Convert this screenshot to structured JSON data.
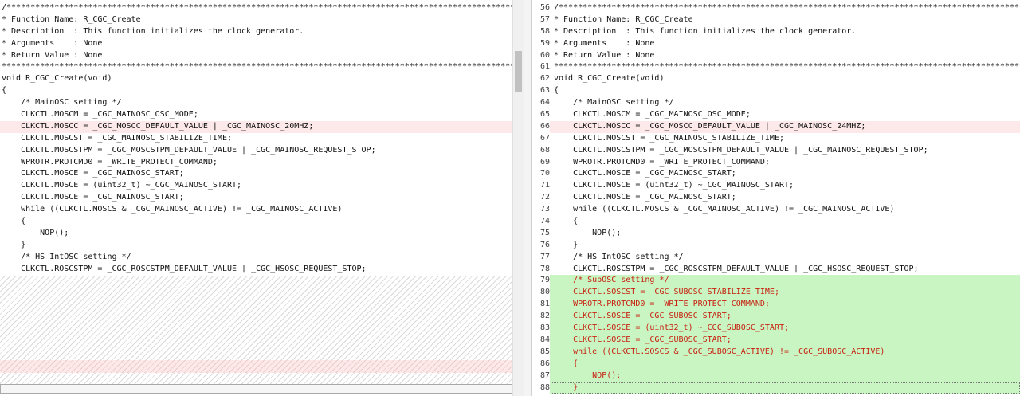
{
  "left_lines": [
    {
      "text": "/*******************************************************************************************************************************",
      "state": "normal"
    },
    {
      "text": "* Function Name: R_CGC_Create",
      "state": "normal"
    },
    {
      "text": "* Description  : This function initializes the clock generator.",
      "state": "normal"
    },
    {
      "text": "* Arguments    : None",
      "state": "normal"
    },
    {
      "text": "* Return Value : None",
      "state": "normal"
    },
    {
      "text": "*******************************************************************************************************************************/",
      "state": "normal"
    },
    {
      "text": "void R_CGC_Create(void)",
      "state": "normal"
    },
    {
      "text": "{",
      "state": "normal"
    },
    {
      "text": "    /* MainOSC setting */",
      "state": "normal"
    },
    {
      "text": "    CLKCTL.MOSCM = _CGC_MAINOSC_OSC_MODE;",
      "state": "normal"
    },
    {
      "text": "    CLKCTL.MOSCC = _CGC_MOSCC_DEFAULT_VALUE | _CGC_MAINOSC_20MHZ;",
      "state": "changed"
    },
    {
      "text": "    CLKCTL.MOSCST = _CGC_MAINOSC_STABILIZE_TIME;",
      "state": "normal"
    },
    {
      "text": "    CLKCTL.MOSCSTPM = _CGC_MOSCSTPM_DEFAULT_VALUE | _CGC_MAINOSC_REQUEST_STOP;",
      "state": "normal"
    },
    {
      "text": "    WPROTR.PROTCMD0 = _WRITE_PROTECT_COMMAND;",
      "state": "normal"
    },
    {
      "text": "    CLKCTL.MOSCE = _CGC_MAINOSC_START;",
      "state": "normal"
    },
    {
      "text": "    CLKCTL.MOSCE = (uint32_t) ~_CGC_MAINOSC_START;",
      "state": "normal"
    },
    {
      "text": "    CLKCTL.MOSCE = _CGC_MAINOSC_START;",
      "state": "normal"
    },
    {
      "text": "    while ((CLKCTL.MOSCS & _CGC_MAINOSC_ACTIVE) != _CGC_MAINOSC_ACTIVE)",
      "state": "normal"
    },
    {
      "text": "    {",
      "state": "normal"
    },
    {
      "text": "        NOP();",
      "state": "normal"
    },
    {
      "text": "    }",
      "state": "normal"
    },
    {
      "text": "    /* HS IntOSC setting */",
      "state": "normal"
    },
    {
      "text": "    CLKCTL.ROSCSTPM = _CGC_ROSCSTPM_DEFAULT_VALUE | _CGC_HSOSC_REQUEST_STOP;",
      "state": "normal"
    }
  ],
  "right_lines": [
    {
      "num": "56",
      "text": "/*****************************************************************************************************************",
      "state": "normal"
    },
    {
      "num": "57",
      "text": "* Function Name: R_CGC_Create",
      "state": "normal"
    },
    {
      "num": "58",
      "text": "* Description  : This function initializes the clock generator.",
      "state": "normal"
    },
    {
      "num": "59",
      "text": "* Arguments    : None",
      "state": "normal"
    },
    {
      "num": "60",
      "text": "* Return Value : None",
      "state": "normal"
    },
    {
      "num": "61",
      "text": "*****************************************************************************************************************/",
      "state": "normal"
    },
    {
      "num": "62",
      "text": "void R_CGC_Create(void)",
      "state": "normal"
    },
    {
      "num": "63",
      "text": "{",
      "state": "normal"
    },
    {
      "num": "64",
      "text": "    /* MainOSC setting */",
      "state": "normal"
    },
    {
      "num": "65",
      "text": "    CLKCTL.MOSCM = _CGC_MAINOSC_OSC_MODE;",
      "state": "normal"
    },
    {
      "num": "66",
      "text": "    CLKCTL.MOSCC = _CGC_MOSCC_DEFAULT_VALUE | _CGC_MAINOSC_24MHZ;",
      "state": "changed"
    },
    {
      "num": "67",
      "text": "    CLKCTL.MOSCST = _CGC_MAINOSC_STABILIZE_TIME;",
      "state": "normal"
    },
    {
      "num": "68",
      "text": "    CLKCTL.MOSCSTPM = _CGC_MOSCSTPM_DEFAULT_VALUE | _CGC_MAINOSC_REQUEST_STOP;",
      "state": "normal"
    },
    {
      "num": "69",
      "text": "    WPROTR.PROTCMD0 = _WRITE_PROTECT_COMMAND;",
      "state": "normal"
    },
    {
      "num": "70",
      "text": "    CLKCTL.MOSCE = _CGC_MAINOSC_START;",
      "state": "normal"
    },
    {
      "num": "71",
      "text": "    CLKCTL.MOSCE = (uint32_t) ~_CGC_MAINOSC_START;",
      "state": "normal"
    },
    {
      "num": "72",
      "text": "    CLKCTL.MOSCE = _CGC_MAINOSC_START;",
      "state": "normal"
    },
    {
      "num": "73",
      "text": "    while ((CLKCTL.MOSCS & _CGC_MAINOSC_ACTIVE) != _CGC_MAINOSC_ACTIVE)",
      "state": "normal"
    },
    {
      "num": "74",
      "text": "    {",
      "state": "normal"
    },
    {
      "num": "75",
      "text": "        NOP();",
      "state": "normal"
    },
    {
      "num": "76",
      "text": "    }",
      "state": "normal"
    },
    {
      "num": "77",
      "text": "    /* HS IntOSC setting */",
      "state": "normal"
    },
    {
      "num": "78",
      "text": "    CLKCTL.ROSCSTPM = _CGC_ROSCSTPM_DEFAULT_VALUE | _CGC_HSOSC_REQUEST_STOP;",
      "state": "normal"
    },
    {
      "num": "79",
      "text": "    /* SubOSC setting */",
      "state": "added"
    },
    {
      "num": "80",
      "text": "    CLKCTL.SOSCST = _CGC_SUBOSC_STABILIZE_TIME;",
      "state": "added"
    },
    {
      "num": "81",
      "text": "    WPROTR.PROTCMD0 = _WRITE_PROTECT_COMMAND;",
      "state": "added"
    },
    {
      "num": "82",
      "text": "    CLKCTL.SOSCE = _CGC_SUBOSC_START;",
      "state": "added"
    },
    {
      "num": "83",
      "text": "    CLKCTL.SOSCE = (uint32_t) ~_CGC_SUBOSC_START;",
      "state": "added"
    },
    {
      "num": "84",
      "text": "    CLKCTL.SOSCE = _CGC_SUBOSC_START;",
      "state": "added"
    },
    {
      "num": "85",
      "text": "    while ((CLKCTL.SOSCS & _CGC_SUBOSC_ACTIVE) != _CGC_SUBOSC_ACTIVE)",
      "state": "added"
    },
    {
      "num": "86",
      "text": "    {",
      "state": "added"
    },
    {
      "num": "87",
      "text": "        NOP();",
      "state": "added"
    },
    {
      "num": "88",
      "text": "    }",
      "state": "added"
    }
  ],
  "colors": {
    "changed_bg": "#fde9e9",
    "added_bg": "#c9f5c3",
    "added_text": "#c8200f"
  }
}
